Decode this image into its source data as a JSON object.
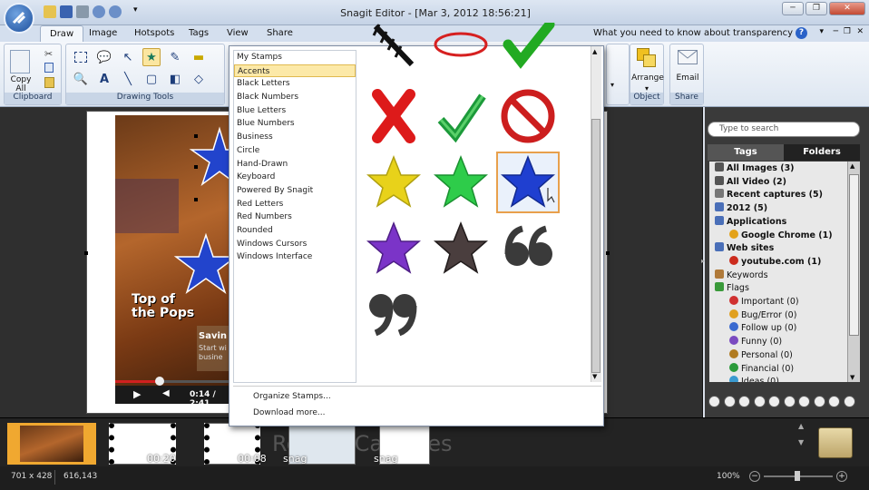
{
  "window": {
    "title": "Snagit Editor - [Mar 3, 2012 18:56:21]"
  },
  "tabs": [
    {
      "label": "Draw"
    },
    {
      "label": "Image"
    },
    {
      "label": "Hotspots"
    },
    {
      "label": "Tags"
    },
    {
      "label": "View"
    },
    {
      "label": "Share"
    }
  ],
  "help_text": "What you need to know about transparency",
  "ribbon": {
    "copy_all": "Copy All",
    "groups": {
      "clipboard": "Clipboard",
      "drawing_tools": "Drawing Tools",
      "object": "Object",
      "share": "Share"
    },
    "arrange": "Arrange",
    "email": "Email"
  },
  "stamp_popup": {
    "categories": [
      "My Stamps",
      "Accents",
      "Black Letters",
      "Black Numbers",
      "Blue Letters",
      "Blue Numbers",
      "Business",
      "Circle",
      "Hand-Drawn",
      "Keyboard",
      "Powered By Snagit",
      "Red Letters",
      "Red Numbers",
      "Rounded",
      "Windows Cursors",
      "Windows Interface"
    ],
    "selected_category": "Accents",
    "stamps": [
      "ribbon-arrow",
      "red-ellipse",
      "green-check-large",
      "red-x",
      "green-check",
      "no-sign",
      "yellow-star",
      "green-star",
      "blue-star",
      "purple-star",
      "dark-star",
      "open-quote",
      "close-quote"
    ],
    "selected_stamp": "blue-star",
    "organize": "Organize Stamps...",
    "download": "Download more..."
  },
  "canvas": {
    "video_text_1": "Top of the Pops",
    "video_text_2": "Savin",
    "video_text_3": "Start wi",
    "video_text_4": "busine",
    "video_time": "0:14 / 2:41"
  },
  "panel": {
    "search_placeholder": "Type to search",
    "tabs": [
      "Tags",
      "Folders"
    ],
    "tree": [
      {
        "label": "All Images (3)",
        "bold": true,
        "indent": 1,
        "color": "#555"
      },
      {
        "label": "All Video (2)",
        "bold": true,
        "indent": 1,
        "color": "#555"
      },
      {
        "label": "Recent captures (5)",
        "bold": true,
        "indent": 1,
        "color": "#777"
      },
      {
        "label": "2012 (5)",
        "bold": true,
        "indent": 1,
        "color": "#4a6fb8"
      },
      {
        "label": "Applications",
        "bold": true,
        "indent": 1,
        "color": "#4a6fb8"
      },
      {
        "label": "Google Chrome (1)",
        "bold": true,
        "indent": 2,
        "color": "#e3a21a"
      },
      {
        "label": "Web sites",
        "bold": true,
        "indent": 1,
        "color": "#4a6fb8"
      },
      {
        "label": "youtube.com (1)",
        "bold": true,
        "indent": 2,
        "color": "#cc2b1d"
      },
      {
        "label": "Keywords",
        "bold": false,
        "indent": 1,
        "color": "#b07a3a"
      },
      {
        "label": "Flags",
        "bold": false,
        "indent": 1,
        "color": "#3a9a3a"
      },
      {
        "label": "Important (0)",
        "bold": false,
        "indent": 2,
        "color": "#d03030"
      },
      {
        "label": "Bug/Error (0)",
        "bold": false,
        "indent": 2,
        "color": "#e0a020"
      },
      {
        "label": "Follow up (0)",
        "bold": false,
        "indent": 2,
        "color": "#3a6ad0"
      },
      {
        "label": "Funny (0)",
        "bold": false,
        "indent": 2,
        "color": "#7a4ac0"
      },
      {
        "label": "Personal (0)",
        "bold": false,
        "indent": 2,
        "color": "#b07a20"
      },
      {
        "label": "Financial (0)",
        "bold": false,
        "indent": 2,
        "color": "#2a9a3a"
      },
      {
        "label": "Ideas (0)",
        "bold": false,
        "indent": 2,
        "color": "#3a9ad0"
      }
    ]
  },
  "tray": {
    "thumbs": [
      {
        "label": ""
      },
      {
        "label": "00:20"
      },
      {
        "label": "00:08"
      },
      {
        "label": "snag"
      },
      {
        "label": "snag"
      }
    ],
    "watermark": "Recent Captures"
  },
  "status": {
    "dimensions": "701 x 428",
    "coords": "616,143",
    "zoom": "100%"
  },
  "colors": {
    "accent": "#2a62c8",
    "selection": "#fce9a8"
  }
}
